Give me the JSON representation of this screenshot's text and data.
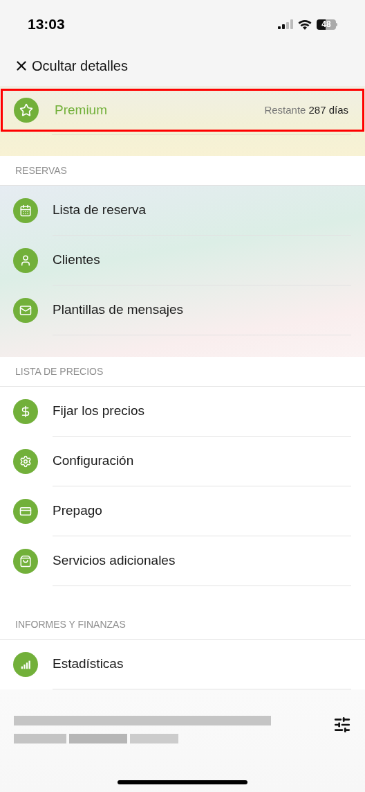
{
  "status_bar": {
    "time": "13:03",
    "battery": "48"
  },
  "header": {
    "close_label": "Ocultar detalles"
  },
  "premium": {
    "title": "Premium",
    "remaining_label": "Restante",
    "remaining_value": "287 días",
    "highlighted": true
  },
  "sections": [
    {
      "title": "RESERVAS",
      "tinted": true,
      "items": [
        {
          "label": "Lista de reserva",
          "kind": "calendar"
        },
        {
          "label": "Clientes",
          "kind": "person"
        },
        {
          "label": "Plantillas de mensajes",
          "kind": "mail"
        }
      ]
    },
    {
      "title": "LISTA DE PRECIOS",
      "tinted": false,
      "items": [
        {
          "label": "Fijar los precios",
          "kind": "dollar"
        },
        {
          "label": "Configuración",
          "kind": "gear"
        },
        {
          "label": "Prepago",
          "kind": "card"
        },
        {
          "label": "Servicios adicionales",
          "kind": "bag"
        }
      ]
    },
    {
      "title": "INFORMES Y FINANZAS",
      "tinted": false,
      "items": [
        {
          "label": "Estadísticas",
          "kind": "chart"
        }
      ]
    }
  ]
}
